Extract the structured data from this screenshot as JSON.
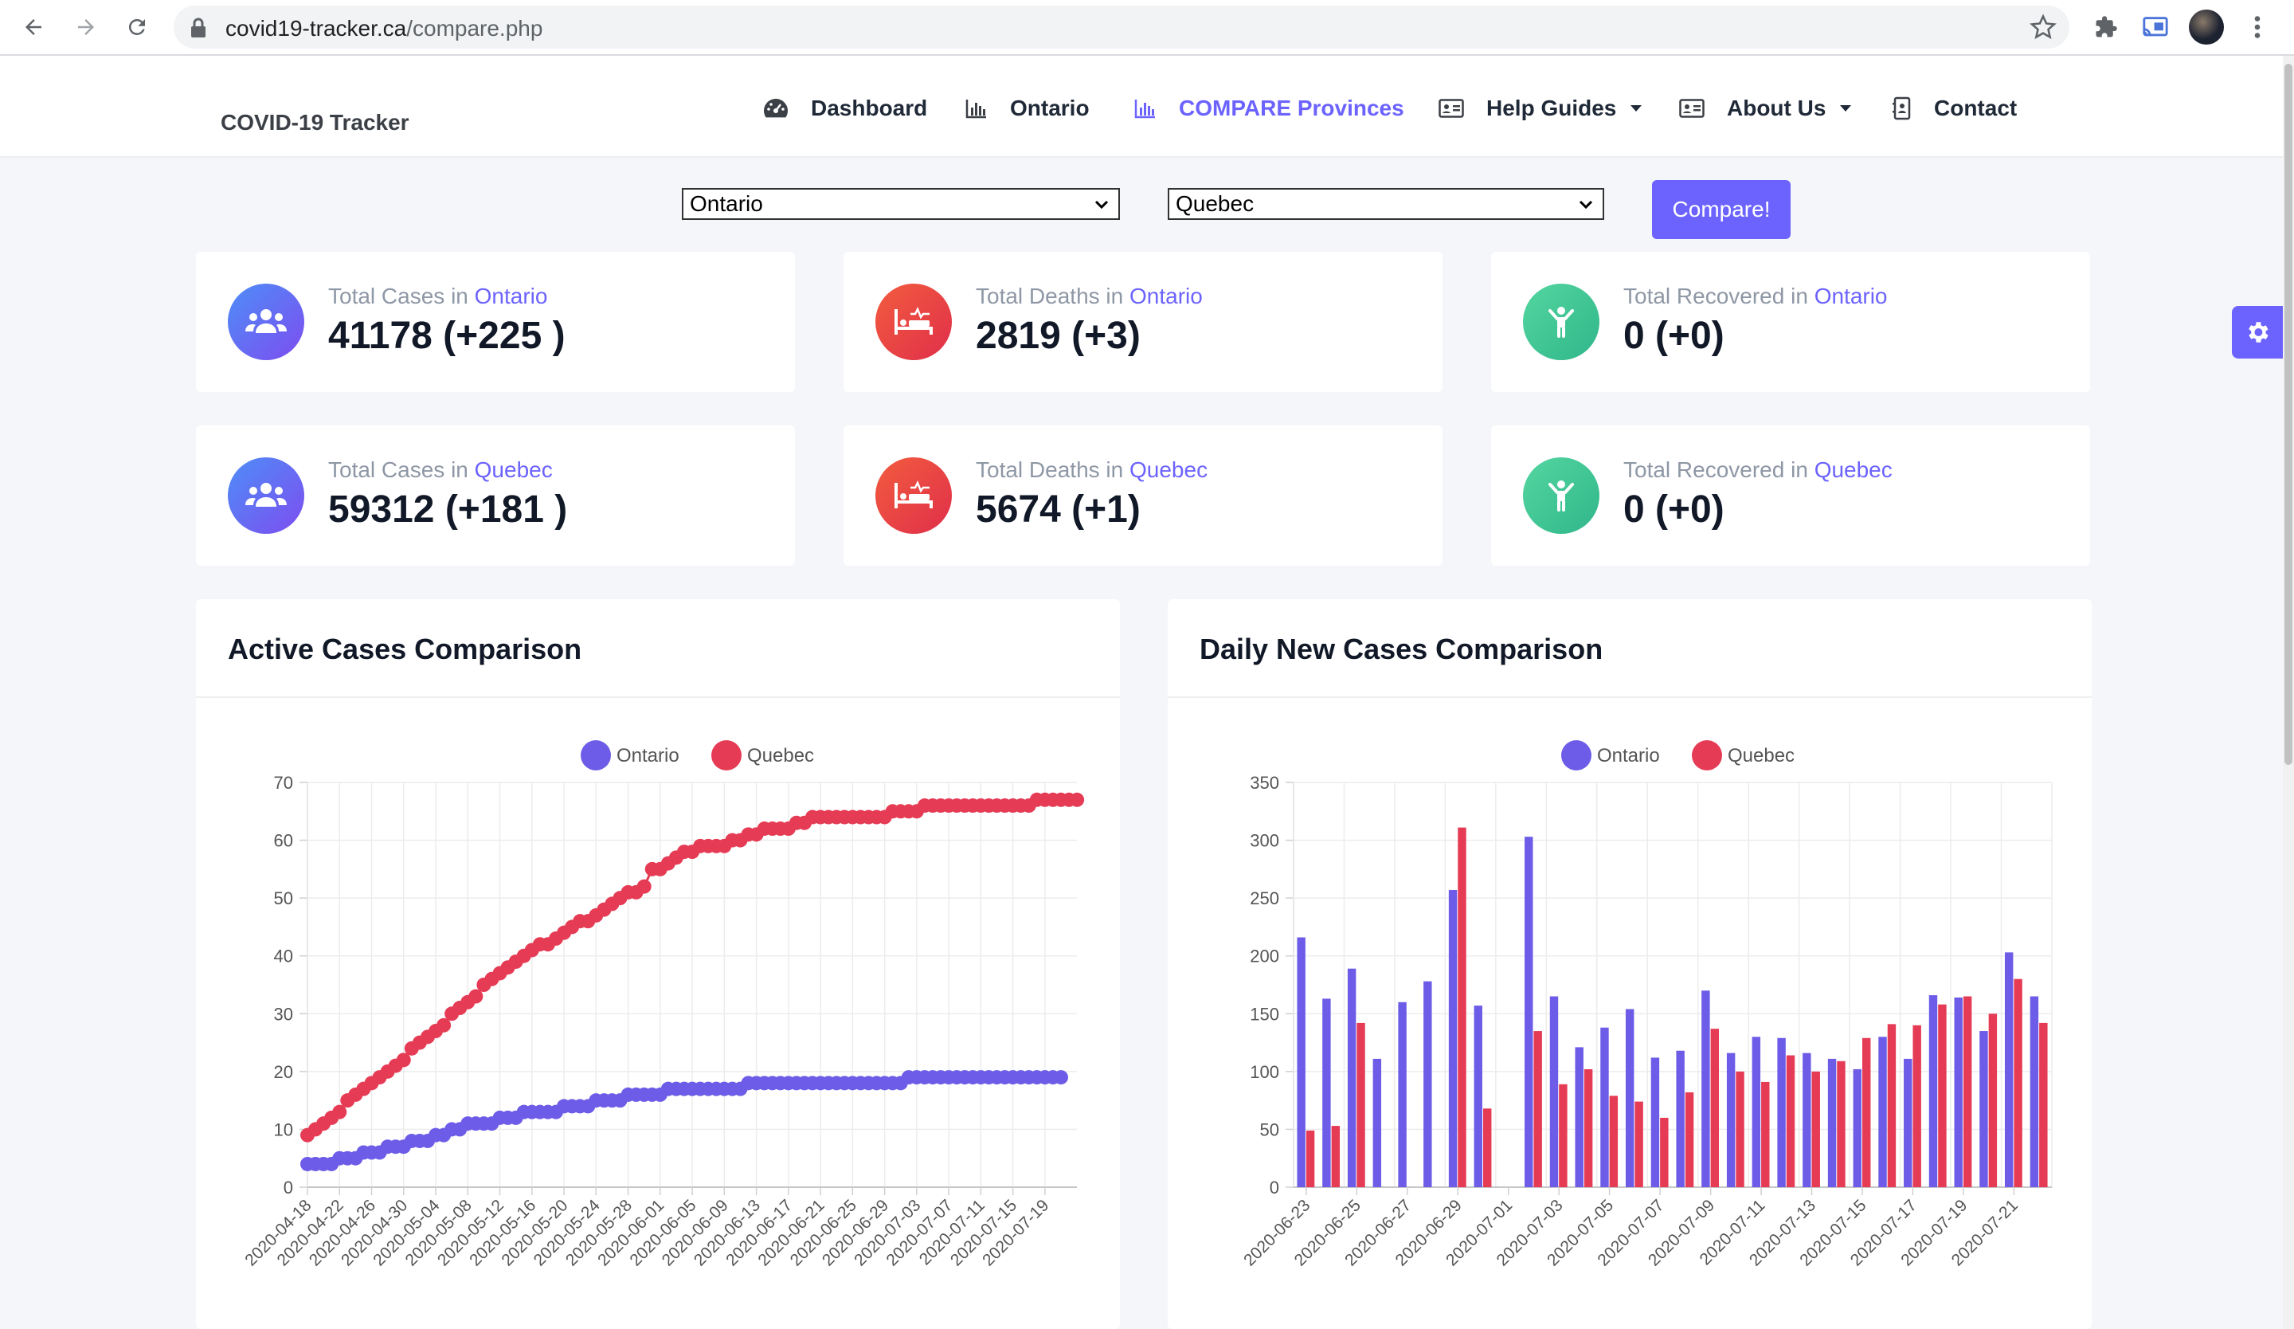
{
  "browser": {
    "url_domain": "covid19-tracker.ca",
    "url_path": "/compare.php"
  },
  "header": {
    "brand": "COVID-19 Tracker",
    "nav": [
      {
        "label": "Dashboard",
        "icon": "dashboard-gauge-icon"
      },
      {
        "label": "Ontario",
        "icon": "bar-chart-icon"
      },
      {
        "label": "COMPARE Provinces",
        "icon": "bar-chart-icon",
        "active": true
      },
      {
        "label": "Help Guides",
        "icon": "id-card-icon",
        "dropdown": true
      },
      {
        "label": "About Us",
        "icon": "id-card-icon",
        "dropdown": true
      },
      {
        "label": "Contact",
        "icon": "contact-book-icon"
      }
    ]
  },
  "compare": {
    "province_a": "Ontario",
    "province_b": "Quebec",
    "button_label": "Compare!"
  },
  "stats": {
    "cases_label": "Total Cases in",
    "deaths_label": "Total Deaths in",
    "recovered_label": "Total Recovered in",
    "row1_region": "Ontario",
    "row2_region": "Quebec",
    "row1": {
      "cases": "41178 (+225 )",
      "deaths": "2819 (+3)",
      "recovered": "0 (+0)"
    },
    "row2": {
      "cases": "59312 (+181 )",
      "deaths": "5674 (+1)",
      "recovered": "0 (+0)"
    }
  },
  "colors": {
    "accent": "#6c63ff",
    "ontario_series": "#6c5ce7",
    "quebec_series": "#e63b55"
  },
  "chart_data": [
    {
      "type": "line",
      "title": "Active Cases Comparison",
      "x_tick_labels": [
        "2020-04-18",
        "2020-04-22",
        "2020-04-26",
        "2020-04-30",
        "2020-05-04",
        "2020-05-08",
        "2020-05-12",
        "2020-05-16",
        "2020-05-20",
        "2020-05-24",
        "2020-05-28",
        "2020-06-01",
        "2020-06-05",
        "2020-06-09",
        "2020-06-13",
        "2020-06-17",
        "2020-06-21",
        "2020-06-25",
        "2020-06-29",
        "2020-07-03",
        "2020-07-07",
        "2020-07-11",
        "2020-07-15",
        "2020-07-19"
      ],
      "ylim": [
        0,
        70
      ],
      "y_ticks": [
        0,
        10,
        20,
        30,
        40,
        50,
        60,
        70
      ],
      "legend": "top-center",
      "grid": true,
      "series": [
        {
          "name": "Ontario",
          "color": "#6c5ce7",
          "values": [
            4,
            4,
            4,
            4,
            5,
            5,
            5,
            6,
            6,
            6,
            7,
            7,
            7,
            8,
            8,
            8,
            9,
            9,
            10,
            10,
            11,
            11,
            11,
            11,
            12,
            12,
            12,
            13,
            13,
            13,
            13,
            13,
            14,
            14,
            14,
            14,
            15,
            15,
            15,
            15,
            16,
            16,
            16,
            16,
            16,
            17,
            17,
            17,
            17,
            17,
            17,
            17,
            17,
            17,
            17,
            18,
            18,
            18,
            18,
            18,
            18,
            18,
            18,
            18,
            18,
            18,
            18,
            18,
            18,
            18,
            18,
            18,
            18,
            18,
            18,
            19,
            19,
            19,
            19,
            19,
            19,
            19,
            19,
            19,
            19,
            19,
            19,
            19,
            19,
            19,
            19,
            19,
            19,
            19,
            19
          ]
        },
        {
          "name": "Quebec",
          "color": "#e63b55",
          "values": [
            9,
            10,
            11,
            12,
            13,
            15,
            16,
            17,
            18,
            19,
            20,
            21,
            22,
            24,
            25,
            26,
            27,
            28,
            30,
            31,
            32,
            33,
            35,
            36,
            37,
            38,
            39,
            40,
            41,
            42,
            42,
            43,
            44,
            45,
            46,
            46,
            47,
            48,
            49,
            50,
            51,
            51,
            52,
            55,
            55,
            56,
            57,
            58,
            58,
            59,
            59,
            59,
            59,
            60,
            60,
            61,
            61,
            62,
            62,
            62,
            62,
            63,
            63,
            64,
            64,
            64,
            64,
            64,
            64,
            64,
            64,
            64,
            64,
            65,
            65,
            65,
            65,
            66,
            66,
            66,
            66,
            66,
            66,
            66,
            66,
            66,
            66,
            66,
            66,
            66,
            66,
            67,
            67,
            67,
            67,
            67,
            67
          ]
        }
      ]
    },
    {
      "type": "bar",
      "title": "Daily New Cases Comparison",
      "categories": [
        "2020-06-23",
        "2020-06-24",
        "2020-06-25",
        "2020-06-26",
        "2020-06-27",
        "2020-06-28",
        "2020-06-29",
        "2020-06-30",
        "2020-07-01",
        "2020-07-02",
        "2020-07-03",
        "2020-07-04",
        "2020-07-05",
        "2020-07-06",
        "2020-07-07",
        "2020-07-08",
        "2020-07-09",
        "2020-07-10",
        "2020-07-11",
        "2020-07-12",
        "2020-07-13",
        "2020-07-14",
        "2020-07-15",
        "2020-07-16",
        "2020-07-17",
        "2020-07-18",
        "2020-07-19",
        "2020-07-20",
        "2020-07-21",
        "2020-07-22"
      ],
      "x_tick_labels": [
        "2020-06-23",
        "2020-06-25",
        "2020-06-27",
        "2020-06-29",
        "2020-07-01",
        "2020-07-03",
        "2020-07-05",
        "2020-07-07",
        "2020-07-09",
        "2020-07-11",
        "2020-07-13",
        "2020-07-15",
        "2020-07-17",
        "2020-07-19",
        "2020-07-21"
      ],
      "ylim": [
        0,
        350
      ],
      "y_ticks": [
        0,
        50,
        100,
        150,
        200,
        250,
        300,
        350
      ],
      "legend": "top-center",
      "grid": true,
      "series": [
        {
          "name": "Ontario",
          "color": "#6c5ce7",
          "values": [
            216,
            163,
            189,
            111,
            160,
            178,
            257,
            157,
            0,
            303,
            165,
            121,
            138,
            154,
            112,
            118,
            170,
            116,
            130,
            129,
            116,
            111,
            102,
            130,
            111,
            166,
            164,
            135,
            203,
            165
          ]
        },
        {
          "name": "Quebec",
          "color": "#e63b55",
          "values": [
            49,
            53,
            142,
            0,
            0,
            0,
            311,
            68,
            0,
            135,
            89,
            102,
            79,
            74,
            60,
            82,
            137,
            100,
            91,
            114,
            100,
            109,
            129,
            141,
            140,
            158,
            165,
            150,
            180,
            142
          ]
        }
      ]
    }
  ]
}
